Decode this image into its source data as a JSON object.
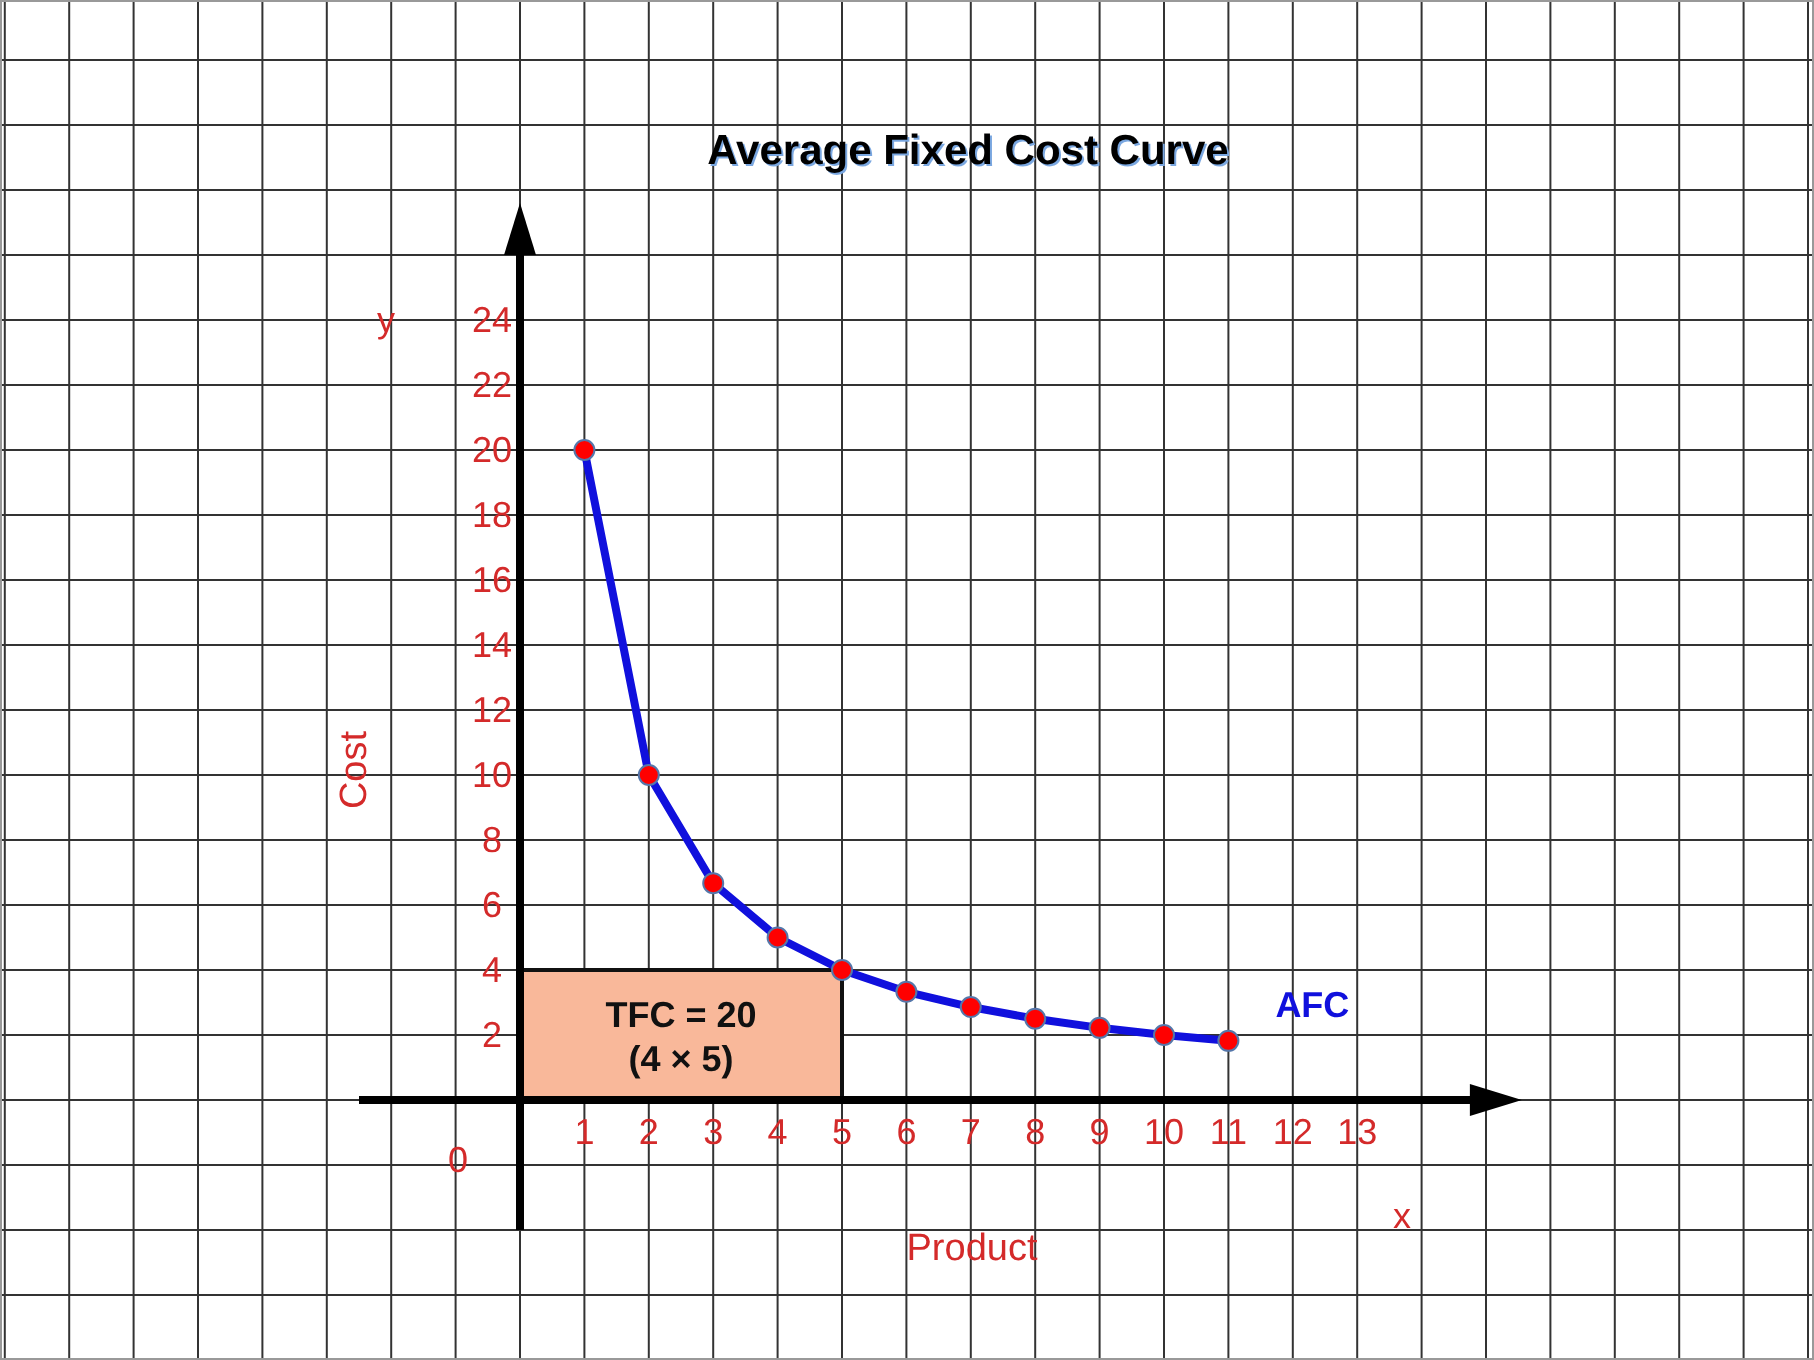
{
  "chart_data": {
    "type": "line",
    "title": "Average Fixed Cost Curve",
    "xlabel": "Product",
    "ylabel": "Cost",
    "x": [
      1,
      2,
      3,
      4,
      5,
      6,
      7,
      8,
      9,
      10,
      11
    ],
    "series": [
      {
        "name": "AFC",
        "color": "#1010dd",
        "marker": "circle",
        "values": [
          20,
          10,
          6.67,
          5,
          4,
          3.33,
          2.86,
          2.5,
          2.22,
          2,
          1.82
        ]
      }
    ],
    "xlim": [
      -2.5,
      14.75
    ],
    "ylim": [
      -4,
      26
    ],
    "xticks": [
      1,
      2,
      3,
      4,
      5,
      6,
      7,
      8,
      9,
      10,
      11,
      12,
      13
    ],
    "yticks": [
      2,
      4,
      6,
      8,
      10,
      12,
      14,
      16,
      18,
      20,
      22,
      24
    ],
    "grid": true,
    "annotations": [
      {
        "text": "TFC = 20",
        "x": 5,
        "y": 4
      },
      "(4 × 5)",
      "0",
      "x",
      "y"
    ]
  }
}
